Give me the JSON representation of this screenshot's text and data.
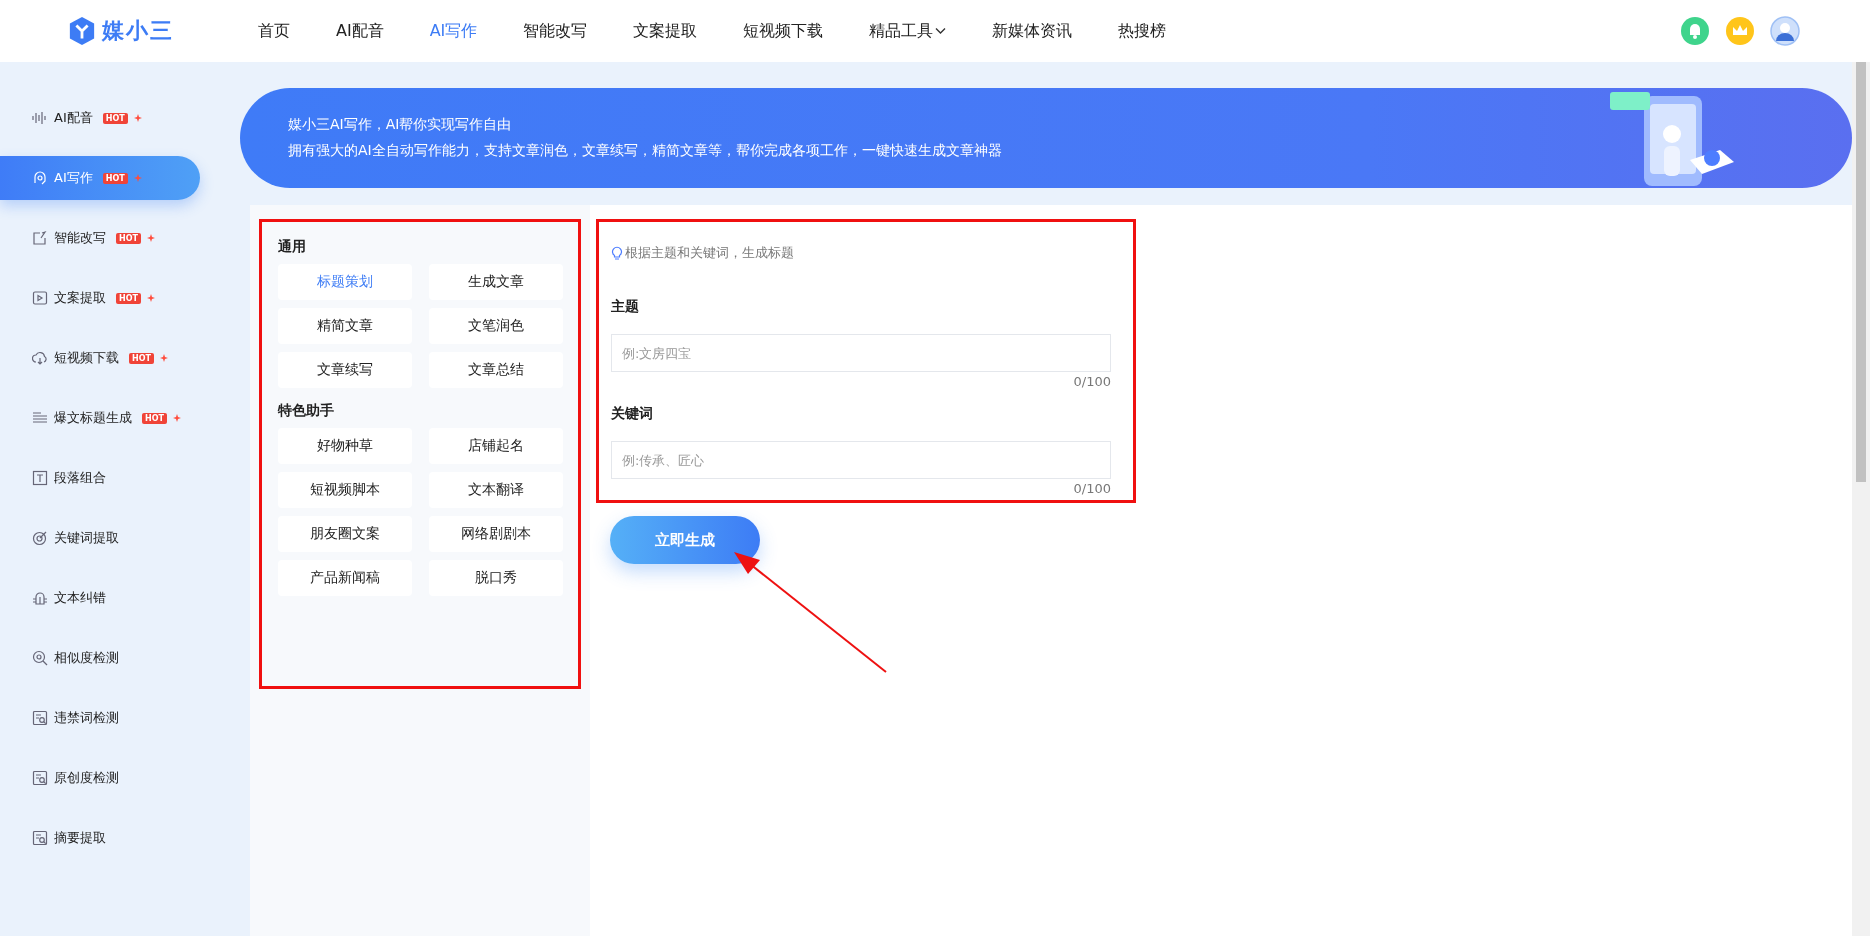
{
  "header": {
    "logo_text": "媒小三",
    "nav": [
      {
        "label": "首页",
        "selected": false,
        "kind": "link"
      },
      {
        "label": "AI配音",
        "selected": false,
        "kind": "link"
      },
      {
        "label": "AI写作",
        "selected": true,
        "kind": "link"
      },
      {
        "label": "智能改写",
        "selected": false,
        "kind": "link"
      },
      {
        "label": "文案提取",
        "selected": false,
        "kind": "link"
      },
      {
        "label": "短视频下载",
        "selected": false,
        "kind": "link"
      },
      {
        "label": "精品工具",
        "selected": false,
        "kind": "dropdown"
      },
      {
        "label": "新媒体资讯",
        "selected": false,
        "kind": "link"
      },
      {
        "label": "热搜榜",
        "selected": false,
        "kind": "link"
      }
    ]
  },
  "sidebar": {
    "items": [
      {
        "label": "AI配音",
        "selected": false,
        "badge": "HOT"
      },
      {
        "label": "AI写作",
        "selected": true,
        "badge": "HOT"
      },
      {
        "label": "智能改写",
        "selected": false,
        "badge": "HOT"
      },
      {
        "label": "文案提取",
        "selected": false,
        "badge": "HOT"
      },
      {
        "label": "短视频下载",
        "selected": false,
        "badge": "HOT"
      },
      {
        "label": "爆文标题生成",
        "selected": false,
        "badge": "HOT"
      },
      {
        "label": "段落组合",
        "selected": false
      },
      {
        "label": "关键词提取",
        "selected": false
      },
      {
        "label": "文本纠错",
        "selected": false
      },
      {
        "label": "相似度检测",
        "selected": false
      },
      {
        "label": "违禁词检测",
        "selected": false
      },
      {
        "label": "原创度检测",
        "selected": false
      },
      {
        "label": "摘要提取",
        "selected": false
      }
    ]
  },
  "banner": {
    "title": "媒小三AI写作，AI帮你实现写作自由",
    "subtitle": "拥有强大的AI全自动写作能力，支持文章润色，文章续写，精简文章等，帮你完成各项工作，一键快速生成文章神器"
  },
  "tools": {
    "sections": [
      {
        "title": "通用",
        "items": [
          {
            "label": "标题策划",
            "selected": true
          },
          {
            "label": "生成文章",
            "selected": false
          },
          {
            "label": "精简文章",
            "selected": false
          },
          {
            "label": "文笔润色",
            "selected": false
          },
          {
            "label": "文章续写",
            "selected": false
          },
          {
            "label": "文章总结",
            "selected": false
          }
        ]
      },
      {
        "title": "特色助手",
        "items": [
          {
            "label": "好物种草",
            "selected": false
          },
          {
            "label": "店铺起名",
            "selected": false
          },
          {
            "label": "短视频脚本",
            "selected": false
          },
          {
            "label": "文本翻译",
            "selected": false
          },
          {
            "label": "朋友圈文案",
            "selected": false
          },
          {
            "label": "网络剧剧本",
            "selected": false
          },
          {
            "label": "产品新闻稿",
            "selected": false
          },
          {
            "label": "脱口秀",
            "selected": false
          }
        ]
      }
    ]
  },
  "form": {
    "hint": "根据主题和关键词，生成标题",
    "fields": [
      {
        "label": "主题",
        "placeholder": "例:文房四宝",
        "counter": "0/100"
      },
      {
        "label": "关键词",
        "placeholder": "例:传承、匠心",
        "counter": "0/100"
      }
    ],
    "submit": "立即生成"
  }
}
